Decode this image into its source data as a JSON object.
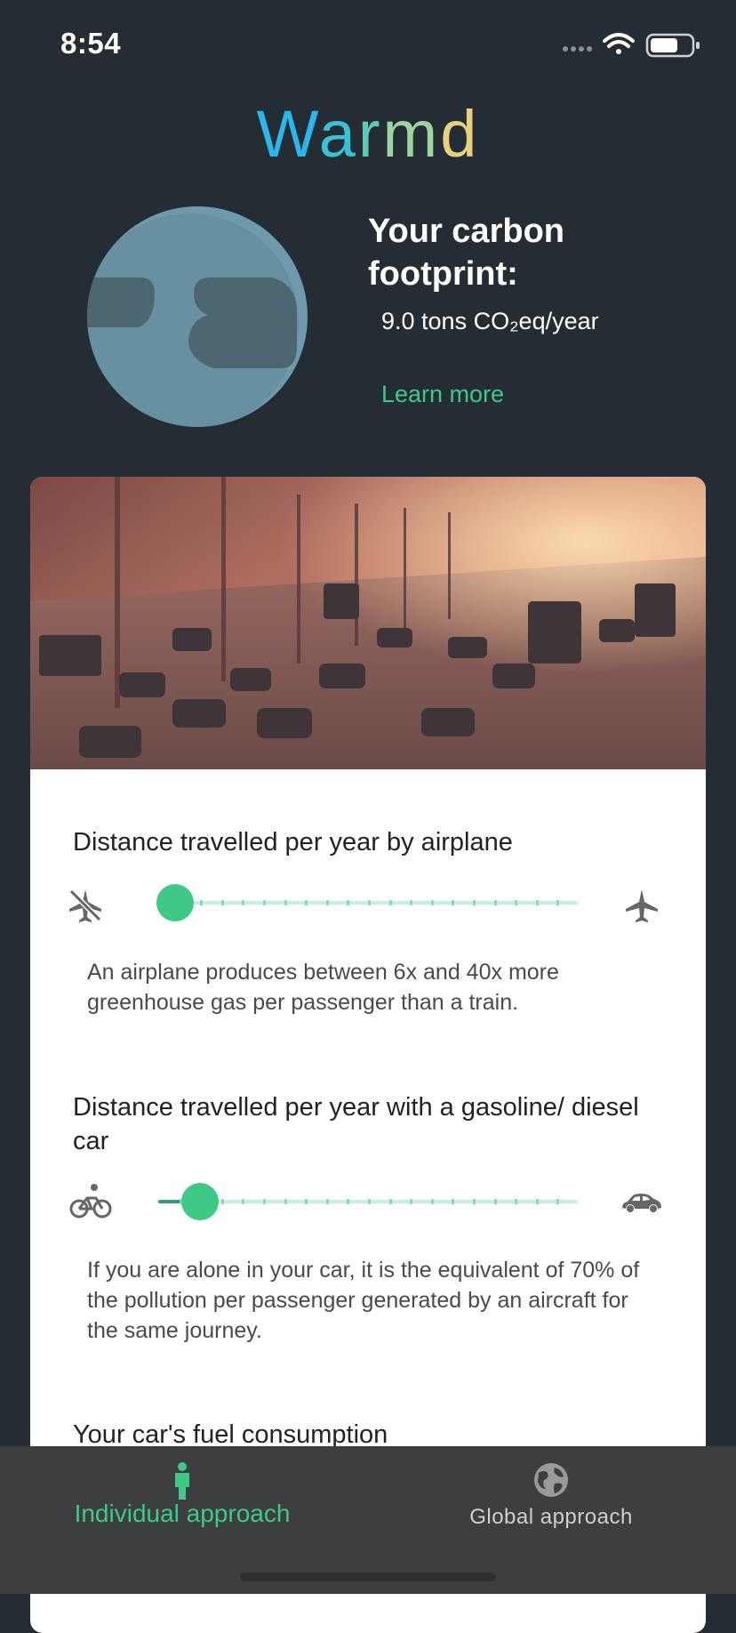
{
  "status_bar": {
    "time": "8:54"
  },
  "app": {
    "name_letters": [
      "W",
      "a",
      "r",
      "m",
      "d"
    ]
  },
  "footprint": {
    "title": "Your carbon footprint:",
    "value": "9.0 tons CO₂eq/year",
    "learn_more": "Learn more"
  },
  "questions": [
    {
      "label": "Distance travelled per year by airplane",
      "note": "An airplane produces between 6x and 40x more greenhouse gas per passenger than a train.",
      "min_icon": "no-airplane-icon",
      "max_icon": "airplane-icon",
      "slider_value": 0.04,
      "steps": 20
    },
    {
      "label": "Distance travelled per year with a gasoline/ diesel car",
      "note": "If you are alone in your car, it is the equivalent of 70% of the pollution per passenger generated by an aircraft for the same journey.",
      "min_icon": "bicycle-icon",
      "max_icon": "car-icon",
      "slider_value": 0.1,
      "steps": 20
    },
    {
      "label": "Your car's fuel consumption"
    }
  ],
  "tabs": [
    {
      "label": "Individual approach",
      "icon": "person-icon",
      "active": true
    },
    {
      "label": "Global approach",
      "icon": "globe-icon",
      "active": false
    }
  ],
  "colors": {
    "accent": "#3ec987",
    "background": "#242d34",
    "tab_bar": "#3d3e40"
  }
}
